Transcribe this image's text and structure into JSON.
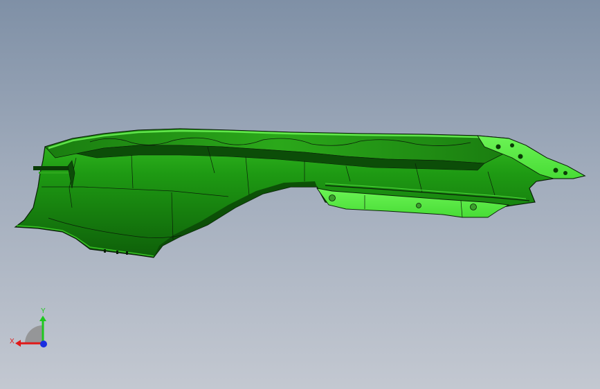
{
  "viewport": {
    "background_top": "#7f90a6",
    "background_bottom": "#c3c8d1"
  },
  "model": {
    "type": "3D CAD part (fender panel)",
    "body_color": "#1f9a12",
    "highlight_color": "#5ef04a",
    "shadow_color": "#0f5a0a",
    "edge_color": "#0a1e08"
  },
  "triad": {
    "x_label": "X",
    "y_label": "Y",
    "x_color": "#e01818",
    "y_color": "#1ec81e",
    "z_color": "#1a2ee0"
  }
}
